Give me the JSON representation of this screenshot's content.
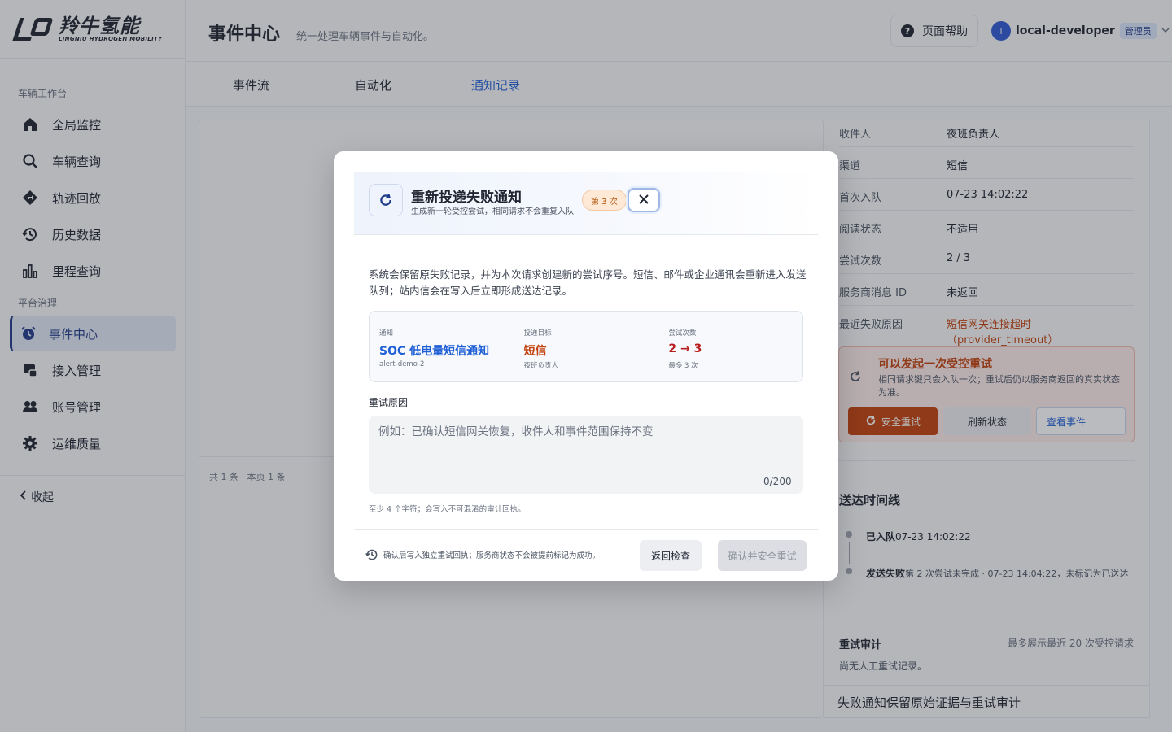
{
  "brand": {
    "name_cn": "羚牛氢能",
    "name_en": "LINGNIU HYDROGEN MOBILITY"
  },
  "sidebar": {
    "group1": "车辆工作台",
    "group2": "平台治理",
    "items": [
      {
        "label": "全局监控",
        "icon": "home-icon"
      },
      {
        "label": "车辆查询",
        "icon": "search-icon"
      },
      {
        "label": "轨迹回放",
        "icon": "route-icon"
      },
      {
        "label": "历史数据",
        "icon": "history-icon"
      },
      {
        "label": "里程查询",
        "icon": "bar-chart-icon"
      },
      {
        "label": "事件中心",
        "icon": "alarm-clock-icon",
        "active": true
      },
      {
        "label": "接入管理",
        "icon": "access-icon"
      },
      {
        "label": "账号管理",
        "icon": "users-icon"
      },
      {
        "label": "运维质量",
        "icon": "gear-icon"
      }
    ],
    "collapse_label": "收起"
  },
  "header": {
    "title": "事件中心",
    "subtitle": "统一处理车辆事件与自动化。",
    "help_label": "页面帮助",
    "avatar_letter": "l",
    "user_name": "local-developer",
    "role": "管理员"
  },
  "tabs": [
    {
      "label": "事件流"
    },
    {
      "label": "自动化"
    },
    {
      "label": "通知记录",
      "active": true
    }
  ],
  "main": {
    "pager": "共 1 条 · 本页 1 条"
  },
  "detail": {
    "rows": [
      {
        "k": "收件人",
        "v": "夜班负责人"
      },
      {
        "k": "渠道",
        "v": "短信"
      },
      {
        "k": "首次入队",
        "v": "07-23 14:02:22"
      },
      {
        "k": "阅读状态",
        "v": "不适用"
      },
      {
        "k": "尝试次数",
        "v": "2 / 3"
      },
      {
        "k": "服务商消息 ID",
        "v": "未返回"
      },
      {
        "k": "最近失败原因",
        "v": "短信网关连接超时（provider_timeout）"
      }
    ],
    "warn_title": "可以发起一次受控重试",
    "warn_desc": "相同请求键只会入队一次；重试后仍以服务商返回的真实状态为准。",
    "btn_safe": "安全重试",
    "btn_refresh": "刷新状态",
    "btn_view": "查看事件",
    "timeline_title": "送达时间线",
    "timeline": [
      {
        "status": "已入队",
        "text": "07-23 14:02:22"
      },
      {
        "status": "发送失败",
        "text": "第 2 次尝试未完成 · 07-23 14:04:22，未标记为已送达"
      }
    ],
    "audit_title": "重试审计",
    "audit_note": "最多展示最近 20 次受控请求",
    "audit_empty": "尚无人工重试记录。",
    "footer": "失败通知保留原始证据与重试审计"
  },
  "modal": {
    "title": "重新投递失败通知",
    "subtitle": "生成新一轮受控尝试，相同请求不会重复入队",
    "attempt_badge": "第 3 次",
    "description": "系统会保留原失败记录，并为本次请求创建新的尝试序号。短信、邮件或企业通讯会重新进入发送队列；站内信会在写入后立即形成送达记录。",
    "info": [
      {
        "label": "通知",
        "value": "SOC 低电量短信通知",
        "sub": "alert-demo-2",
        "color": "blue"
      },
      {
        "label": "投递目标",
        "value": "短信",
        "sub": "夜班负责人",
        "color": "orange"
      },
      {
        "label": "尝试次数",
        "value": "2 → 3",
        "sub": "最多 3 次",
        "color": "red"
      }
    ],
    "reason_label": "重试原因",
    "reason_placeholder": "例如：已确认短信网关恢复，收件人和事件范围保持不变",
    "reason_value": "",
    "counter": "0/200",
    "hint": "至少 4 个字符；会写入不可混淆的审计回执。",
    "foot_note": "确认后写入独立重试回执；服务商状态不会被提前标记为成功。",
    "btn_back": "返回检查",
    "btn_confirm": "确认并安全重试"
  }
}
